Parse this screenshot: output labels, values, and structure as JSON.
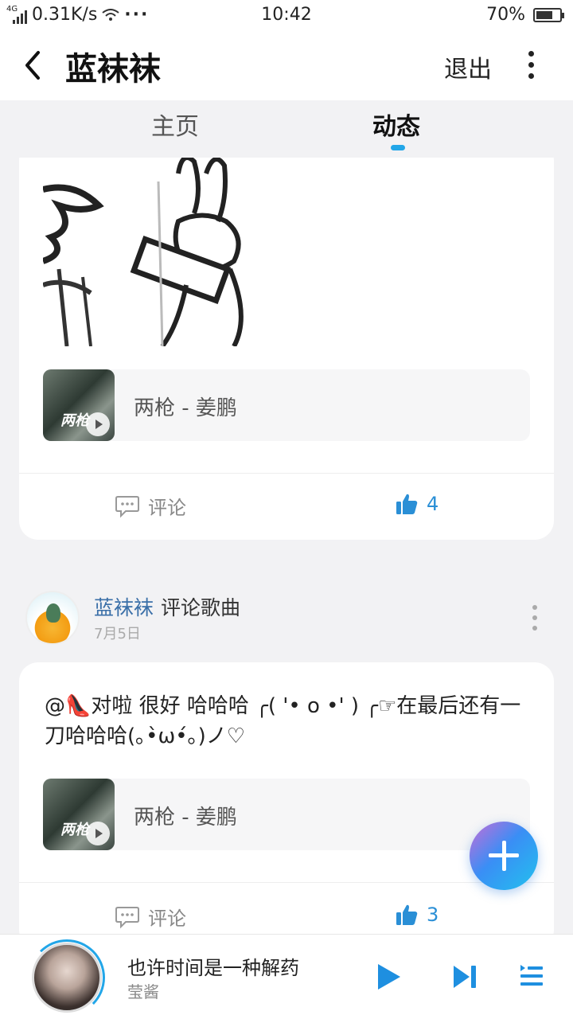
{
  "status_bar": {
    "network_label": "4G",
    "speed": "0.31K/s",
    "overflow": "···",
    "time": "10:42",
    "battery_percent": "70%",
    "battery_level": 0.7
  },
  "app_bar": {
    "title": "蓝袜袜",
    "exit_label": "退出"
  },
  "tabs": [
    {
      "label": "主页",
      "active": false
    },
    {
      "label": "动态",
      "active": true
    }
  ],
  "accent_color": "#22a6e8",
  "posts": [
    {
      "song": "两枪 - 姜鹏",
      "cover_text": "两枪",
      "comment_label": "评论",
      "likes": "4"
    },
    {
      "username": "蓝袜袜",
      "action": "评论歌曲",
      "date": "7月5日",
      "text": "@👠对啦 很好 哈哈哈 ╭( '• o •' ) ╭☞在最后还有一刀哈哈哈(｡•̀ω•́｡)ノ♡",
      "song": "两枪 - 姜鹏",
      "cover_text": "两枪",
      "comment_label": "评论",
      "likes": "3"
    }
  ],
  "player": {
    "title": "也许时间是一种解药",
    "artist": "莹酱"
  }
}
